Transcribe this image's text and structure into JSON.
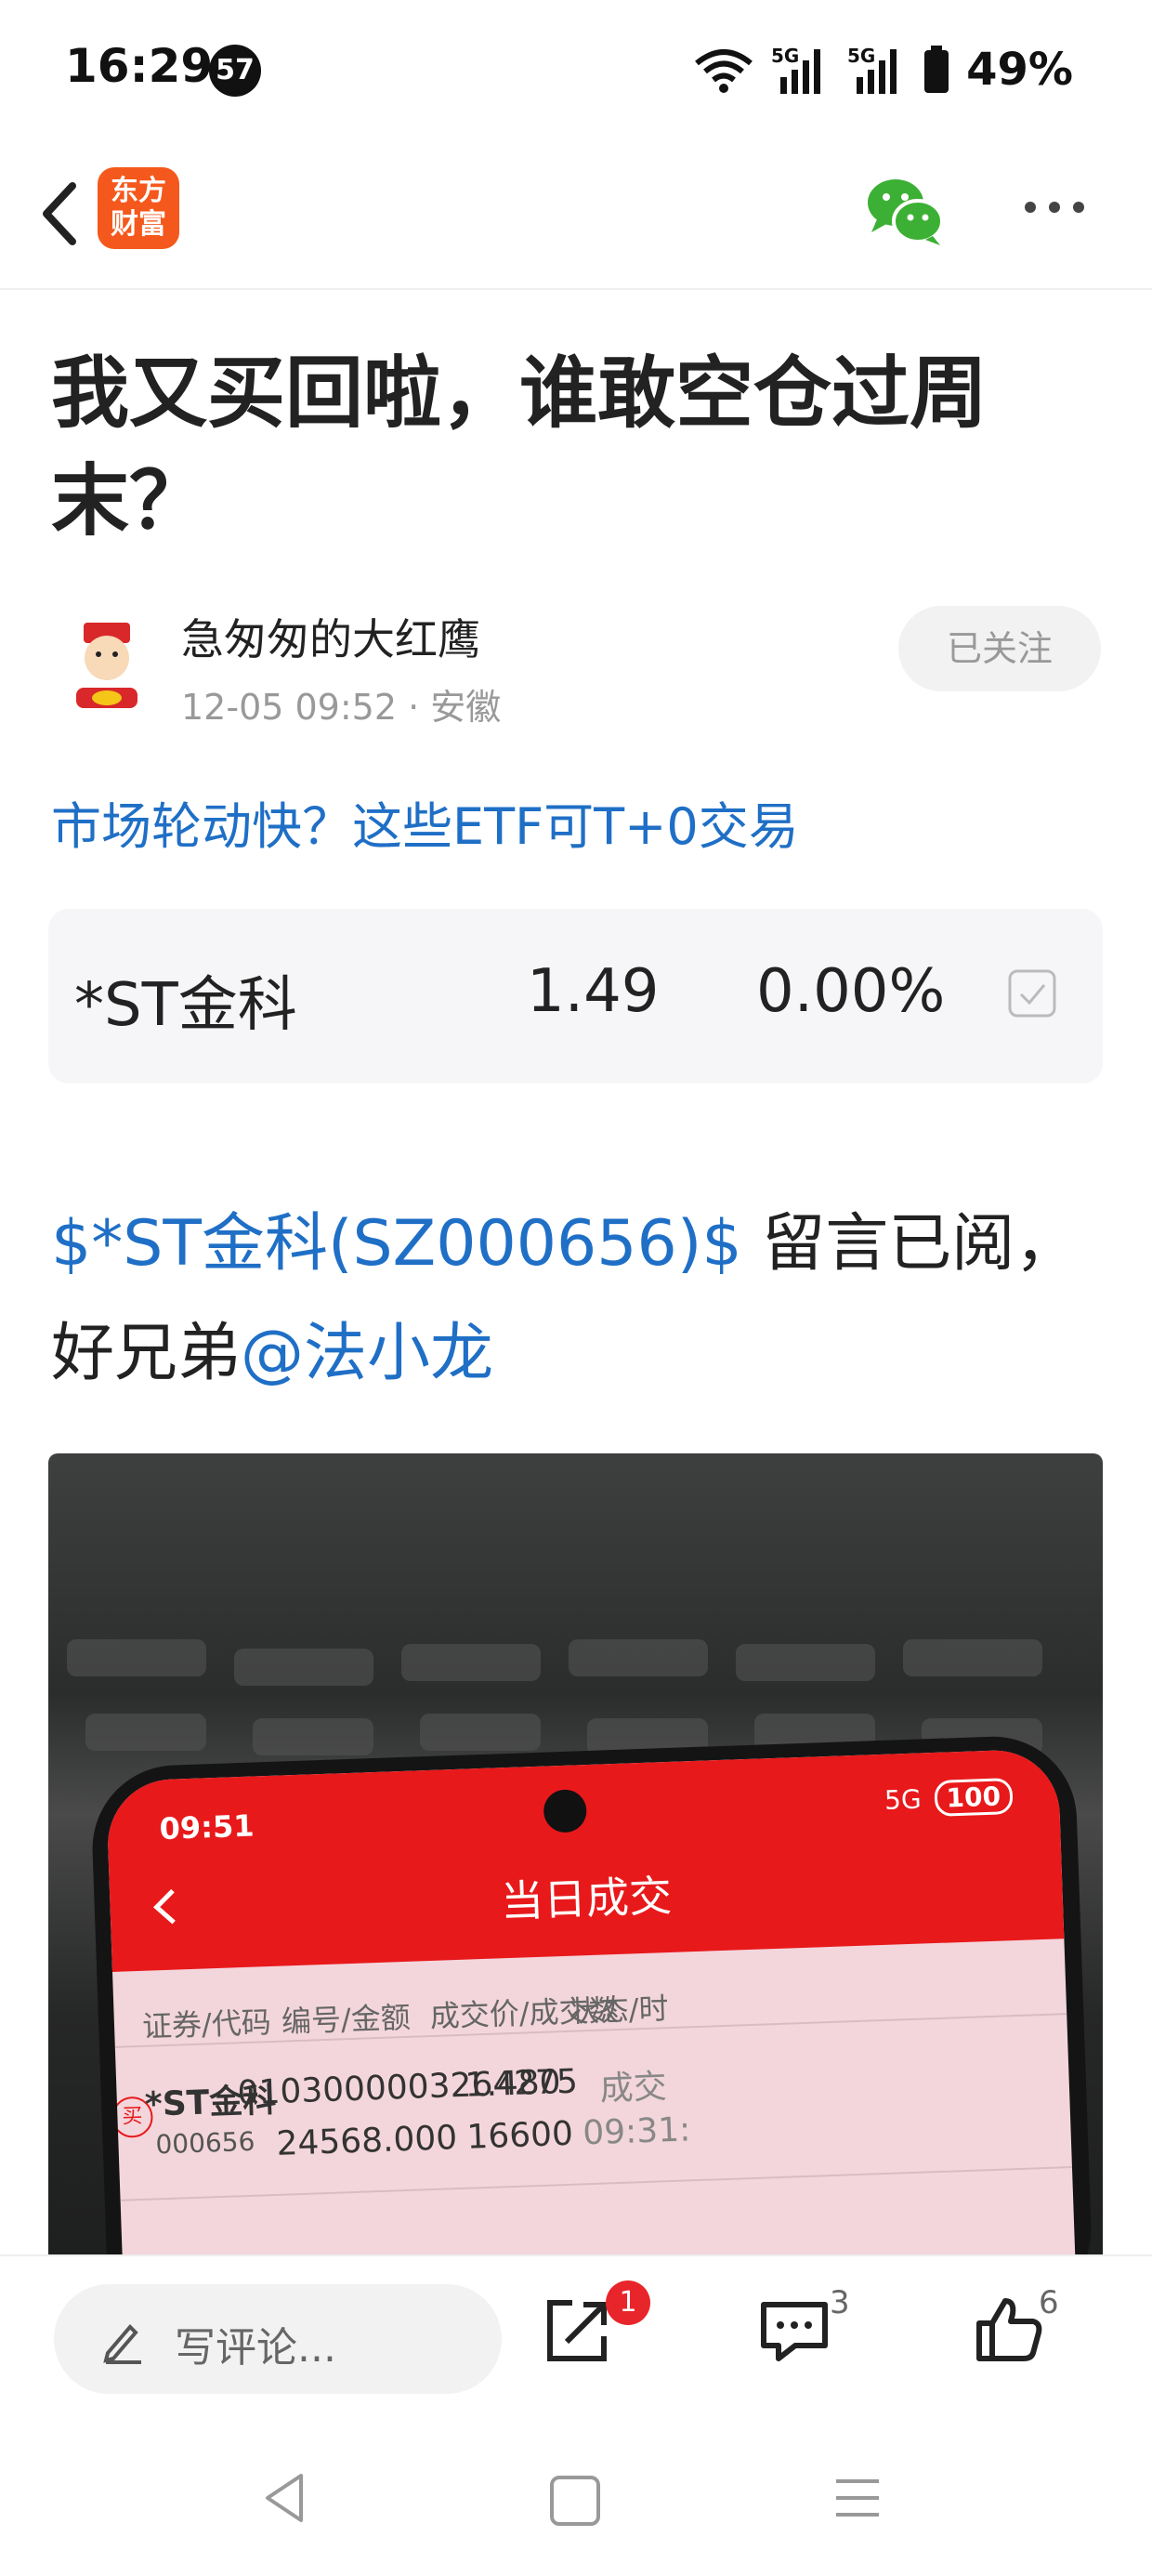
{
  "status_bar": {
    "time": "16:29",
    "notification_count": "57",
    "battery": "49%"
  },
  "header": {
    "app_logo": "东方\n财富",
    "app_logo_line1": "东方",
    "app_logo_line2": "财富"
  },
  "article": {
    "title": "我又买回啦，谁敢空仓过周末？",
    "author": "急匆匆的大红鹰",
    "date": "12-05 09:52",
    "location": "· 安徽",
    "follow_label": "已关注",
    "promo_link": "市场轮动快？这些ETF可T+0交易",
    "stock_card": {
      "name": "*ST金科",
      "price": "1.49",
      "change": "0.00%"
    },
    "body": {
      "stock_link": "$*ST金科(SZ000656)$",
      "text1": " 留言已阅，好兄弟",
      "mention": "@法小龙"
    }
  },
  "photo": {
    "time": "09:51",
    "status": "5G",
    "battery": "100",
    "title": "当日成交",
    "headers": [
      "证券/代码",
      "编号/金额",
      "成交价/成交数",
      "状态/时"
    ],
    "row": {
      "name": "*ST金科",
      "code": "000656",
      "id": "0103000003264275",
      "amount": "24568.000",
      "price": "1.480",
      "volume": "16600",
      "status": "成交",
      "time": "09:31:"
    },
    "seal": "买"
  },
  "bottom_bar": {
    "comment_placeholder": "写评论...",
    "share_badge": "1",
    "comment_count": "3",
    "like_count": "6"
  },
  "colors": {
    "link": "#1f6fc6",
    "brand": "#f5581c",
    "badge": "#e8252a",
    "wechat": "#3cb034"
  }
}
